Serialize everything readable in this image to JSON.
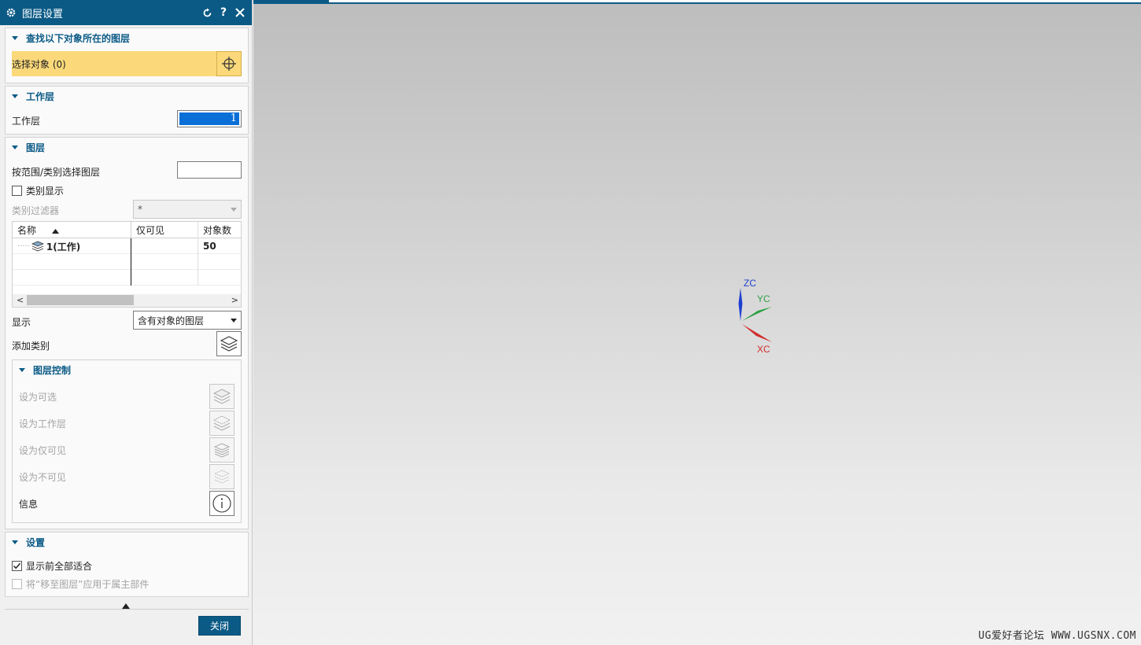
{
  "dialog": {
    "title": "图层设置",
    "title_icon": "gear-icon",
    "title_buttons": [
      "reset-icon",
      "help-icon",
      "close-icon"
    ]
  },
  "find_section": {
    "header": "查找以下对象所在的图层",
    "select_label": "选择对象 (0)",
    "select_icon": "crosshair-icon"
  },
  "work_layer_section": {
    "header": "工作层",
    "label": "工作层",
    "value": "1"
  },
  "layers_section": {
    "header": "图层",
    "range_label": "按范围/类别选择图层",
    "range_value": "",
    "category_display_label": "类别显示",
    "category_display_checked": false,
    "category_filter_label": "类别过滤器",
    "category_filter_value": "*",
    "table": {
      "columns": [
        "名称",
        "仅可见",
        "对象数"
      ],
      "rows": [
        {
          "name": "1(工作)",
          "visible_only": "",
          "count": "50"
        }
      ]
    },
    "display_label": "显示",
    "display_value": "含有对象的图层",
    "add_category_label": "添加类别",
    "control": {
      "header": "图层控制",
      "items": [
        {
          "label": "设为可选",
          "enabled": false
        },
        {
          "label": "设为工作层",
          "enabled": false
        },
        {
          "label": "设为仅可见",
          "enabled": false
        },
        {
          "label": "设为不可见",
          "enabled": false
        },
        {
          "label": "信息",
          "enabled": true
        }
      ]
    }
  },
  "settings_section": {
    "header": "设置",
    "fit_label": "显示前全部适合",
    "fit_checked": true,
    "move_label": "将“移至图层”应用于属主部件",
    "move_checked": false,
    "move_enabled": false
  },
  "close_button": "关闭",
  "viewport": {
    "triad": {
      "z_label": "ZC",
      "y_label": "YC",
      "x_label": "XC",
      "z_color": "#1f3fd0",
      "y_color": "#2ea043",
      "x_color": "#d22b2b"
    },
    "watermark": "UG爱好者论坛 WWW.UGSNX.COM"
  },
  "colors": {
    "accent": "#0b5a86",
    "highlight": "#fbd97a",
    "selection": "#0a6fd6"
  }
}
